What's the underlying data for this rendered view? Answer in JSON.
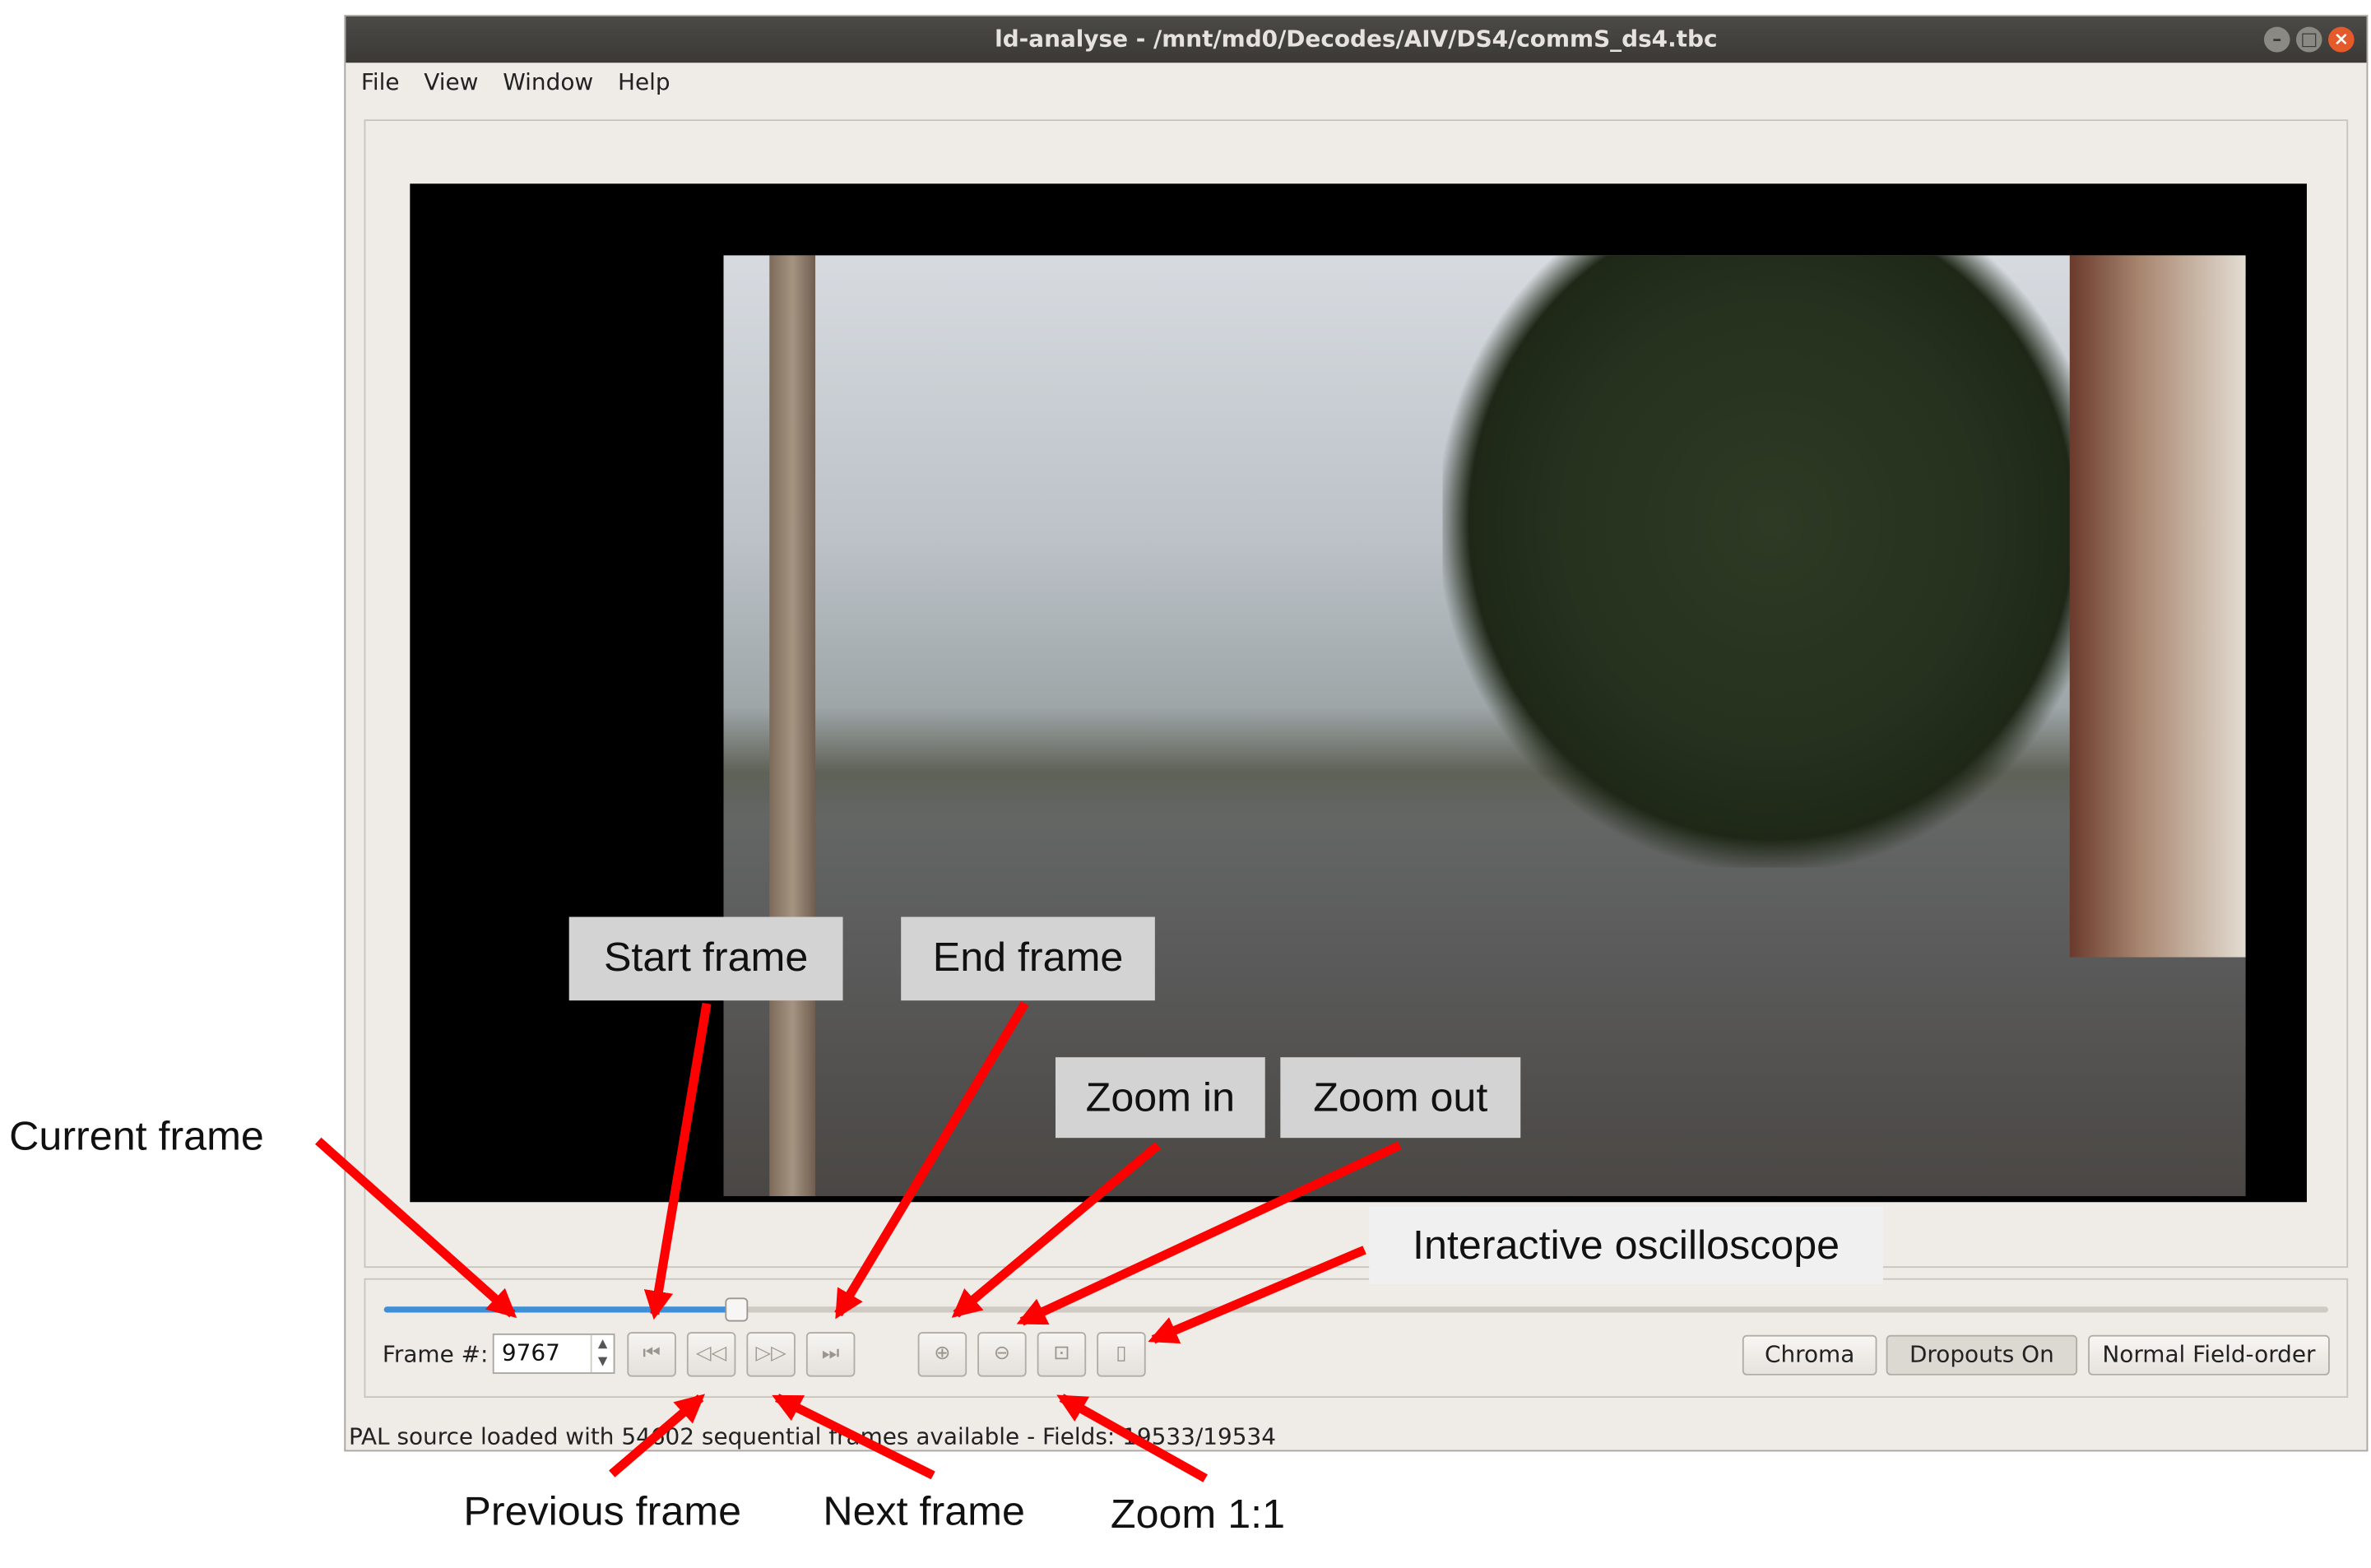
{
  "window": {
    "title": "ld-analyse - /mnt/md0/Decodes/AIV/DS4/commS_ds4.tbc",
    "controls": {
      "minimize": "–",
      "maximize": "□",
      "close": "×"
    }
  },
  "menu": [
    "File",
    "View",
    "Window",
    "Help"
  ],
  "player": {
    "frame_label": "Frame #:",
    "frame_value": "9767",
    "position_fraction": 0.18,
    "buttons": {
      "start": "⏮",
      "previous": "◁◁",
      "next": "▷▷",
      "end": "⏭",
      "zoom_in": "⊕",
      "zoom_out": "⊖",
      "zoom_1to1": "⊡",
      "oscilloscope": "▯"
    },
    "right_buttons": {
      "chroma": "Chroma",
      "dropouts": "Dropouts On",
      "field_order": "Normal Field-order"
    }
  },
  "status": "PAL source loaded with 54602 sequential frames available  -  Fields: 19533/19534",
  "annotations": {
    "start_frame": "Start frame",
    "end_frame": "End frame",
    "zoom_in": "Zoom in",
    "zoom_out": "Zoom out",
    "oscilloscope": "Interactive oscilloscope",
    "current_frame": "Current frame",
    "previous_frame": "Previous frame",
    "next_frame": "Next frame",
    "zoom_1to1": "Zoom 1:1"
  },
  "colors": {
    "arrow": "#ff0000",
    "slider": "#3d8fd6",
    "titlebar": "#3c3b37"
  },
  "icons": {
    "start": "skip-to-start-icon",
    "previous": "step-back-icon",
    "next": "step-forward-icon",
    "end": "skip-to-end-icon",
    "zoom_in": "zoom-in-icon",
    "zoom_out": "zoom-out-icon",
    "zoom_1to1": "zoom-original-icon",
    "oscilloscope": "mouse-icon"
  }
}
